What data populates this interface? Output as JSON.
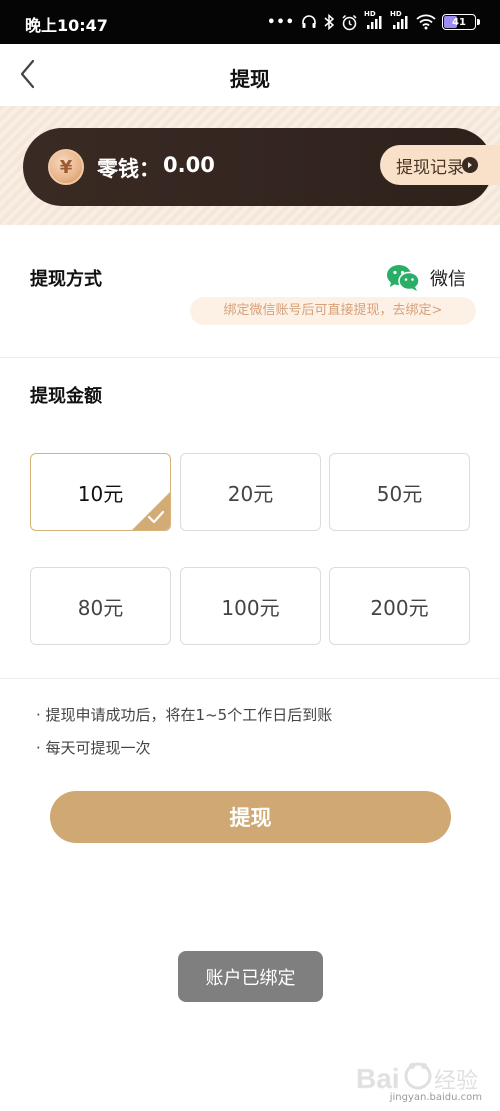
{
  "status_bar": {
    "time": "晚上10:47",
    "signal_label_1": "HD",
    "signal_label_2": "HD",
    "battery": "41"
  },
  "nav": {
    "title": "提现"
  },
  "balance": {
    "label": "零钱：",
    "amount": "0.00",
    "records_label": "提现记录",
    "coin_symbol": "¥"
  },
  "method": {
    "title": "提现方式",
    "option_label": "微信",
    "bind_hint": "绑定微信账号后可直接提现，去绑定>"
  },
  "amount": {
    "title": "提现金额",
    "options": [
      "10元",
      "20元",
      "50元",
      "80元",
      "100元",
      "200元"
    ],
    "selected": "10元"
  },
  "notes": [
    "· 提现申请成功后，将在1~5个工作日后到账",
    "· 每天可提现一次"
  ],
  "submit_label": "提现",
  "toast": "账户已绑定",
  "watermark": {
    "url": "jingyan.baidu.com"
  },
  "colors": {
    "accent": "#cfa873",
    "card_dark": "#3a2a24",
    "wechat_green": "#2aae67",
    "hint_text": "#d5a07b"
  }
}
